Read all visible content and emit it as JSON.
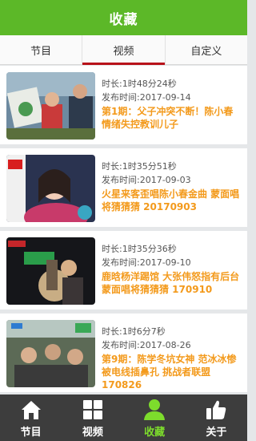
{
  "header": {
    "title": "收藏"
  },
  "tabs": [
    {
      "label": "节目"
    },
    {
      "label": "视频"
    },
    {
      "label": "自定义"
    }
  ],
  "videos": [
    {
      "duration": "时长:1时48分24秒",
      "published": "发布时间:2017-09-14",
      "title": "第1期：父子冲突不断！陈小春情绪失控教训儿子"
    },
    {
      "duration": "时长:1时35分51秒",
      "published": "发布时间:2017-09-03",
      "title": "火星来客歪唱陈小春金曲 蒙面唱将猜猜猜 20170903"
    },
    {
      "duration": "时长:1时35分36秒",
      "published": "发布时间:2017-09-10",
      "title": "鹿晗杨洋踢馆 大张伟怒指有后台 蒙面唱将猜猜猜 170910"
    },
    {
      "duration": "时长:1时6分7秒",
      "published": "发布时间:2017-08-26",
      "title": "第9期：陈学冬坑女神 范冰冰惨被电线插鼻孔 挑战者联盟 170826"
    }
  ],
  "nav": [
    {
      "label": "节目",
      "icon": "home-icon"
    },
    {
      "label": "视频",
      "icon": "grid-icon"
    },
    {
      "label": "收藏",
      "icon": "person-icon"
    },
    {
      "label": "关于",
      "icon": "thumbs-up-icon"
    }
  ],
  "colors": {
    "accent": "#5cb828",
    "tab_indicator": "#b8121a",
    "title_text": "#f39a1c",
    "nav_bg": "#3d3d3d",
    "nav_active": "#7ddc2c"
  }
}
